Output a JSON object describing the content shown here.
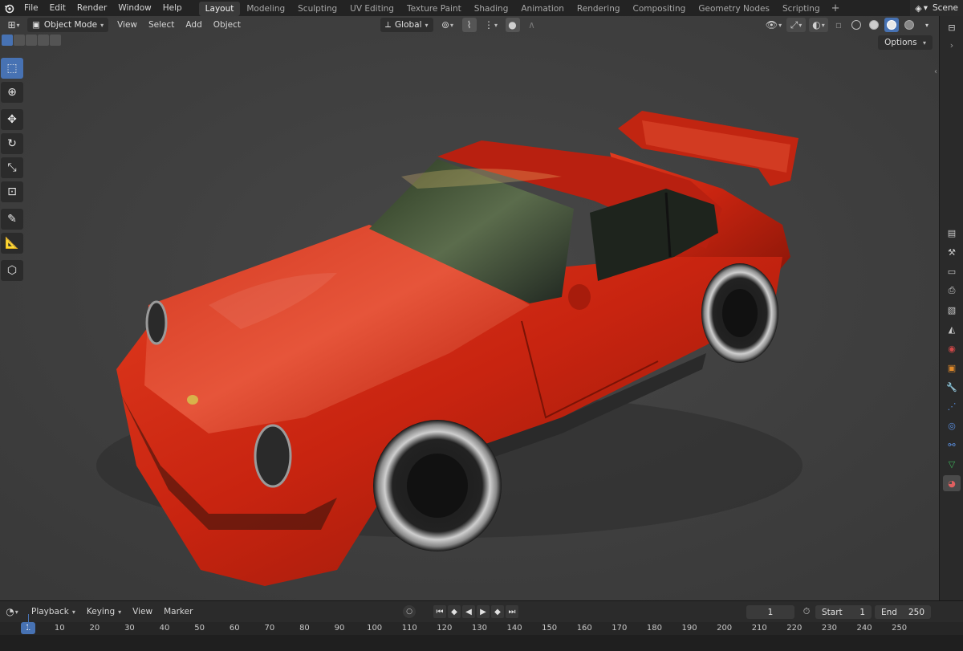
{
  "topbar": {
    "menus": [
      "File",
      "Edit",
      "Render",
      "Window",
      "Help"
    ],
    "workspaces": [
      "Layout",
      "Modeling",
      "Sculpting",
      "UV Editing",
      "Texture Paint",
      "Shading",
      "Animation",
      "Rendering",
      "Compositing",
      "Geometry Nodes",
      "Scripting"
    ],
    "active_workspace": "Layout",
    "add_tab": "+",
    "scene_label": "Scene"
  },
  "viewport": {
    "mode": "Object Mode",
    "menus": [
      "View",
      "Select",
      "Add",
      "Object"
    ],
    "transform_orientation": "Global",
    "options_label": "Options",
    "tools": [
      "select-box-icon",
      "cursor-icon",
      "move-icon",
      "rotate-icon",
      "scale-icon",
      "transform-icon",
      "annotate-icon",
      "measure-icon",
      "add-cube-icon"
    ],
    "active_tool": "select-box-icon"
  },
  "timeline": {
    "menus": [
      "Playback",
      "Keying",
      "View",
      "Marker"
    ],
    "current_frame": "1",
    "start_label": "Start",
    "start_value": "1",
    "end_label": "End",
    "end_value": "250",
    "ruler_marks": [
      "1",
      "10",
      "20",
      "30",
      "40",
      "50",
      "60",
      "70",
      "80",
      "90",
      "100",
      "110",
      "120",
      "130",
      "140",
      "150",
      "160",
      "170",
      "180",
      "190",
      "200",
      "210",
      "220",
      "230",
      "240",
      "250"
    ]
  },
  "colors": {
    "accent": "#4772b3",
    "viewport_bg": "#3d3d3d",
    "car_body": "#c8220e"
  },
  "properties_icons": [
    "tool-icon",
    "render-icon",
    "output-icon",
    "view-layer-icon",
    "scene-icon",
    "world-icon",
    "object-icon",
    "modifier-icon",
    "particles-icon",
    "physics-icon",
    "constraints-icon",
    "data-icon",
    "material-icon"
  ]
}
